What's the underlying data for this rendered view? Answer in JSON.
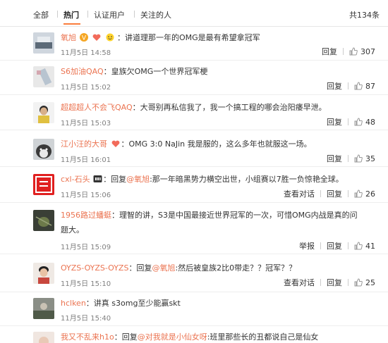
{
  "tabs": {
    "all": "全部",
    "hot": "热门",
    "verified": "认证用户",
    "following": "关注的人",
    "total": "共134条"
  },
  "actions": {
    "reply": "回复",
    "view_conversation": "查看对话",
    "report": "举报"
  },
  "colors": {
    "accent": "#eb7350",
    "tab_underline": "#fa7d3c",
    "muted": "#808080"
  },
  "comments": [
    {
      "user": "氧旭",
      "separator": "：",
      "text": "讲道理那一年的OMG是最有希望拿冠军",
      "time": "11月5日 14:58",
      "likes": "307",
      "badges": [
        "vip-v-icon",
        "heart-badge-icon",
        "emoji-face-icon"
      ]
    },
    {
      "user": "S6加油QAQ",
      "separator": "：",
      "text": "皇族欠OMG一个世界冠军梗",
      "time": "11月5日 15:02",
      "likes": "87"
    },
    {
      "user": "超超超人不会飞QAQ",
      "separator": "：",
      "text": "大哥别再私信我了，我一个搞工程的哪会治阳痿早泄。",
      "time": "11月5日 15:03",
      "likes": "48"
    },
    {
      "user": "江小汪的大哥",
      "separator": "：",
      "text": "OMG 3:0 NaJin 我是服的，这么多年也就服这一场。",
      "time": "11月5日 16:01",
      "likes": "35",
      "badges": [
        "heart-badge-icon"
      ]
    },
    {
      "user": "cxl-石头",
      "reply_prefix": "：回复",
      "at": "@氧旭",
      "text": ":那一年暗黑势力横空出世，小组赛以7胜一负惊艳全球。",
      "time": "11月5日 15:06",
      "likes": "26",
      "badges": [
        "level-badge-icon"
      ],
      "view_conversation": true
    },
    {
      "user": "1956路过蟠蜓",
      "separator": "：",
      "text": "理智的讲，S3是中国最接近世界冠军的一次，可惜OMG内战是真的问",
      "text2": "题大。",
      "time": "11月5日 15:09",
      "likes": "41",
      "report": true
    },
    {
      "user": "OYZS-OYZS-OYZS",
      "reply_prefix": "：回复",
      "at": "@氧旭",
      "text": ":然后被皇族2比0带走？？冠军？？",
      "time": "11月5日 15:10",
      "likes": "25",
      "view_conversation": true
    },
    {
      "user": "hclken",
      "separator": "：",
      "text": "讲真 s3omg至少能赢skt",
      "time": "11月5日 15:40",
      "likes": ""
    },
    {
      "user": "我又不乱来h1o",
      "reply_prefix": "：回复",
      "at": "@对我就是小仙女呀",
      "text": ":班里那些长的丑都说自己是仙女",
      "time": "",
      "likes": ""
    }
  ]
}
